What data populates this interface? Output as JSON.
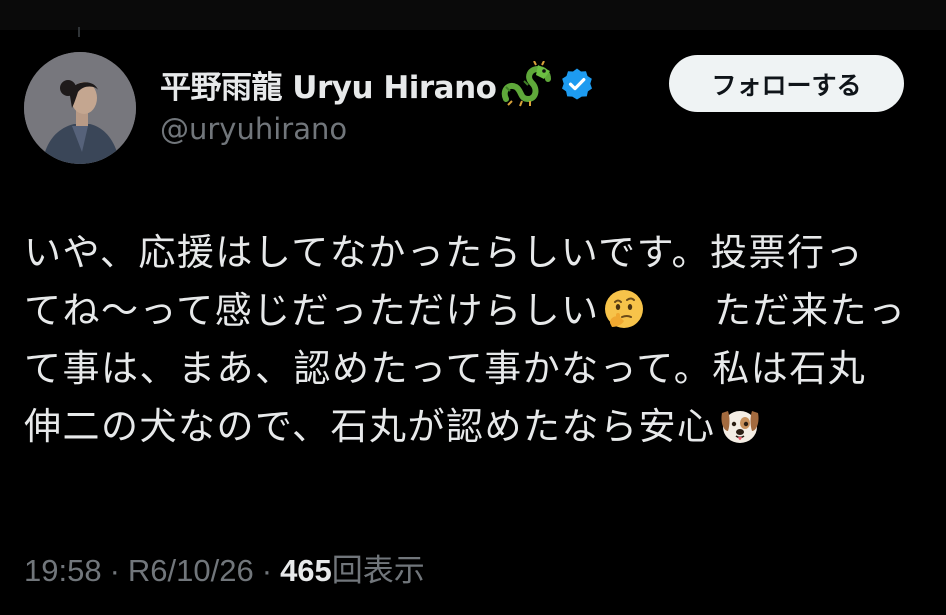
{
  "author": {
    "display_name": "平野雨龍 Uryu Hirano",
    "display_name_emoji": "dragon-emoji",
    "verified_badge": "verified-badge-icon",
    "handle": "@uryuhirano",
    "avatar": "profile-photo"
  },
  "follow_button": {
    "label": "フォローする"
  },
  "tweet": {
    "lines": [
      "いや、応援はしてなかったらしいです。投票行っ",
      "てね〜って感じだっただけらしい",
      "ただ来たっ",
      "て事は、まあ、認めたって事かなって。私は石丸",
      "伸二の犬なので、石丸が認めたなら安心"
    ],
    "emojis": [
      "thinking-face-emoji",
      "dog-face-emoji"
    ]
  },
  "meta": {
    "time": "19:58",
    "date": "R6/10/26",
    "views_count": "465",
    "views_label": "回表示",
    "separator": "·"
  },
  "colors": {
    "background": "#000000",
    "primary_text": "#e7e9ea",
    "secondary_text": "#71767b",
    "verified_blue": "#1d9bf0",
    "follow_button_bg": "#eff3f4"
  }
}
